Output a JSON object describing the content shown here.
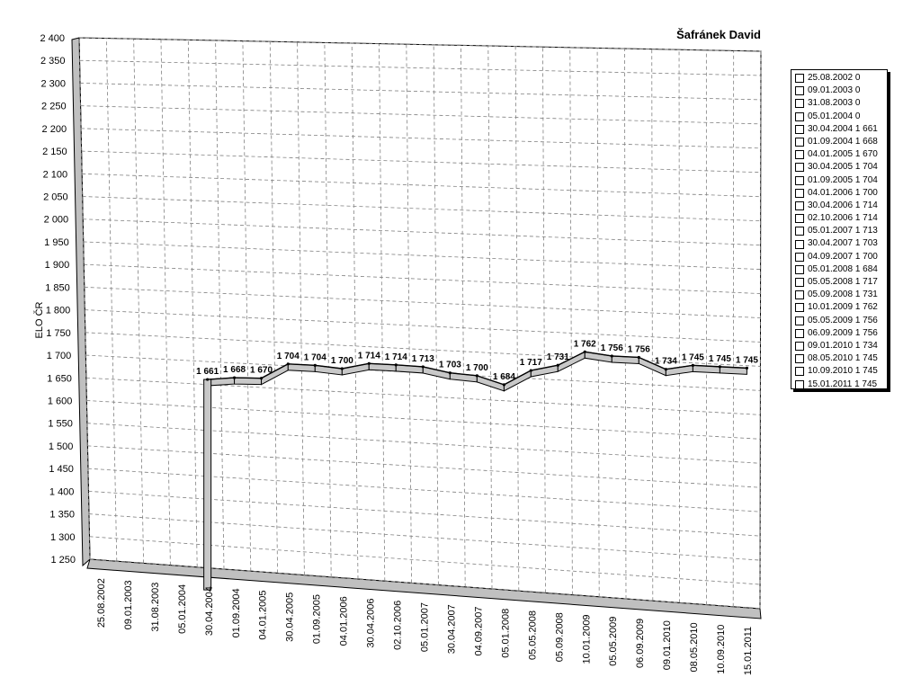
{
  "chart_data": {
    "type": "line",
    "title": "Šafránek David",
    "xlabel": "",
    "ylabel": "ELO ČR",
    "ylim": [
      1250,
      2400
    ],
    "ytick_step": 50,
    "grid": true,
    "legend_position": "right",
    "categories": [
      "25.08.2002",
      "09.01.2003",
      "31.08.2003",
      "05.01.2004",
      "30.04.2004",
      "01.09.2004",
      "04.01.2005",
      "30.04.2005",
      "01.09.2005",
      "04.01.2006",
      "30.04.2006",
      "02.10.2006",
      "05.01.2007",
      "30.04.2007",
      "04.09.2007",
      "05.01.2008",
      "05.05.2008",
      "05.09.2008",
      "10.01.2009",
      "05.05.2009",
      "06.09.2009",
      "09.01.2010",
      "08.05.2010",
      "10.09.2010",
      "15.01.2011"
    ],
    "values": [
      0,
      0,
      0,
      0,
      1661,
      1668,
      1670,
      1704,
      1704,
      1700,
      1714,
      1714,
      1713,
      1703,
      1700,
      1684,
      1717,
      1731,
      1762,
      1756,
      1756,
      1734,
      1745,
      1745,
      1745
    ],
    "data_labels": [
      "",
      "",
      "",
      "",
      "1 661",
      "1 668",
      "1 670",
      "1 704",
      "1 704",
      "1 700",
      "1 714",
      "1 714",
      "1 713",
      "1 703",
      "1 700",
      "1 684",
      "1 717",
      "1 731",
      "1 762",
      "1 756",
      "1 756",
      "1 734",
      "1 745",
      "1 745",
      "1 745"
    ],
    "ytick_labels": [
      "1 250",
      "1 300",
      "1 350",
      "1 400",
      "1 450",
      "1 500",
      "1 550",
      "1 600",
      "1 650",
      "1 700",
      "1 750",
      "1 800",
      "1 850",
      "1 900",
      "1 950",
      "2 000",
      "2 050",
      "2 100",
      "2 150",
      "2 200",
      "2 250",
      "2 300",
      "2 350",
      "2 400"
    ],
    "legend": [
      "25.08.2002 0",
      "09.01.2003 0",
      "31.08.2003 0",
      "05.01.2004 0",
      "30.04.2004 1 661",
      "01.09.2004 1 668",
      "04.01.2005 1 670",
      "30.04.2005 1 704",
      "01.09.2005 1 704",
      "04.01.2006 1 700",
      "30.04.2006 1 714",
      "02.10.2006 1 714",
      "05.01.2007 1 713",
      "30.04.2007 1 703",
      "04.09.2007 1 700",
      "05.01.2008 1 684",
      "05.05.2008 1 717",
      "05.09.2008 1 731",
      "10.01.2009 1 762",
      "05.05.2009 1 756",
      "06.09.2009 1 756",
      "09.01.2010 1 734",
      "08.05.2010 1 745",
      "10.09.2010 1 745",
      "15.01.2011 1 745"
    ],
    "colors": {
      "series_line": "#000000",
      "series_fill": "#ffffff",
      "grid": "#808080",
      "wall": "#c0c0c0"
    }
  }
}
